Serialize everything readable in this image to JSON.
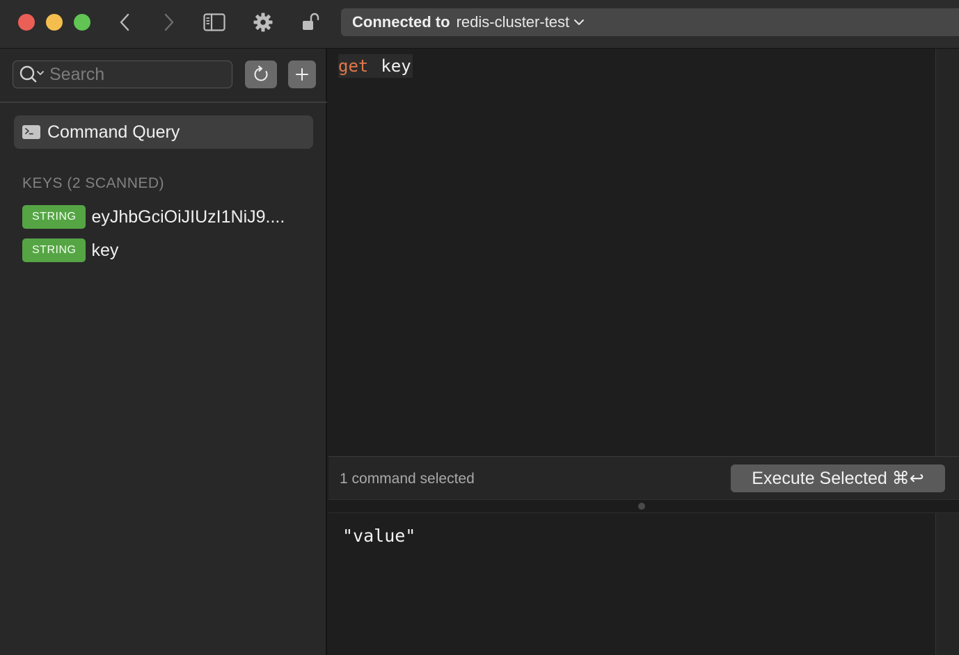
{
  "window": {
    "connection_label": "Connected to",
    "connection_name": "redis-cluster-test"
  },
  "toolbar": {
    "icons": [
      "chevron-left-icon",
      "chevron-right-icon",
      "sidebar-toggle-icon",
      "gear-icon",
      "unlock-icon",
      "chevron-down-icon"
    ]
  },
  "sidebar": {
    "search_placeholder": "Search",
    "command_query_label": "Command Query",
    "keys_header": "KEYS (2 SCANNED)",
    "keys": [
      {
        "type": "STRING",
        "name": "eyJhbGciOiJIUzI1NiJ9...."
      },
      {
        "type": "STRING",
        "name": "key"
      }
    ]
  },
  "editor": {
    "command": "get",
    "argument": "key"
  },
  "status": {
    "selection_text": "1 command selected",
    "execute_label": "Execute Selected ⌘↩"
  },
  "result": {
    "value": "\"value\""
  },
  "colors": {
    "badge_string": "#56a545",
    "keyword": "#e0784a",
    "close": "#ec5f57",
    "minimize": "#f4be4f",
    "maximize": "#61c454"
  }
}
